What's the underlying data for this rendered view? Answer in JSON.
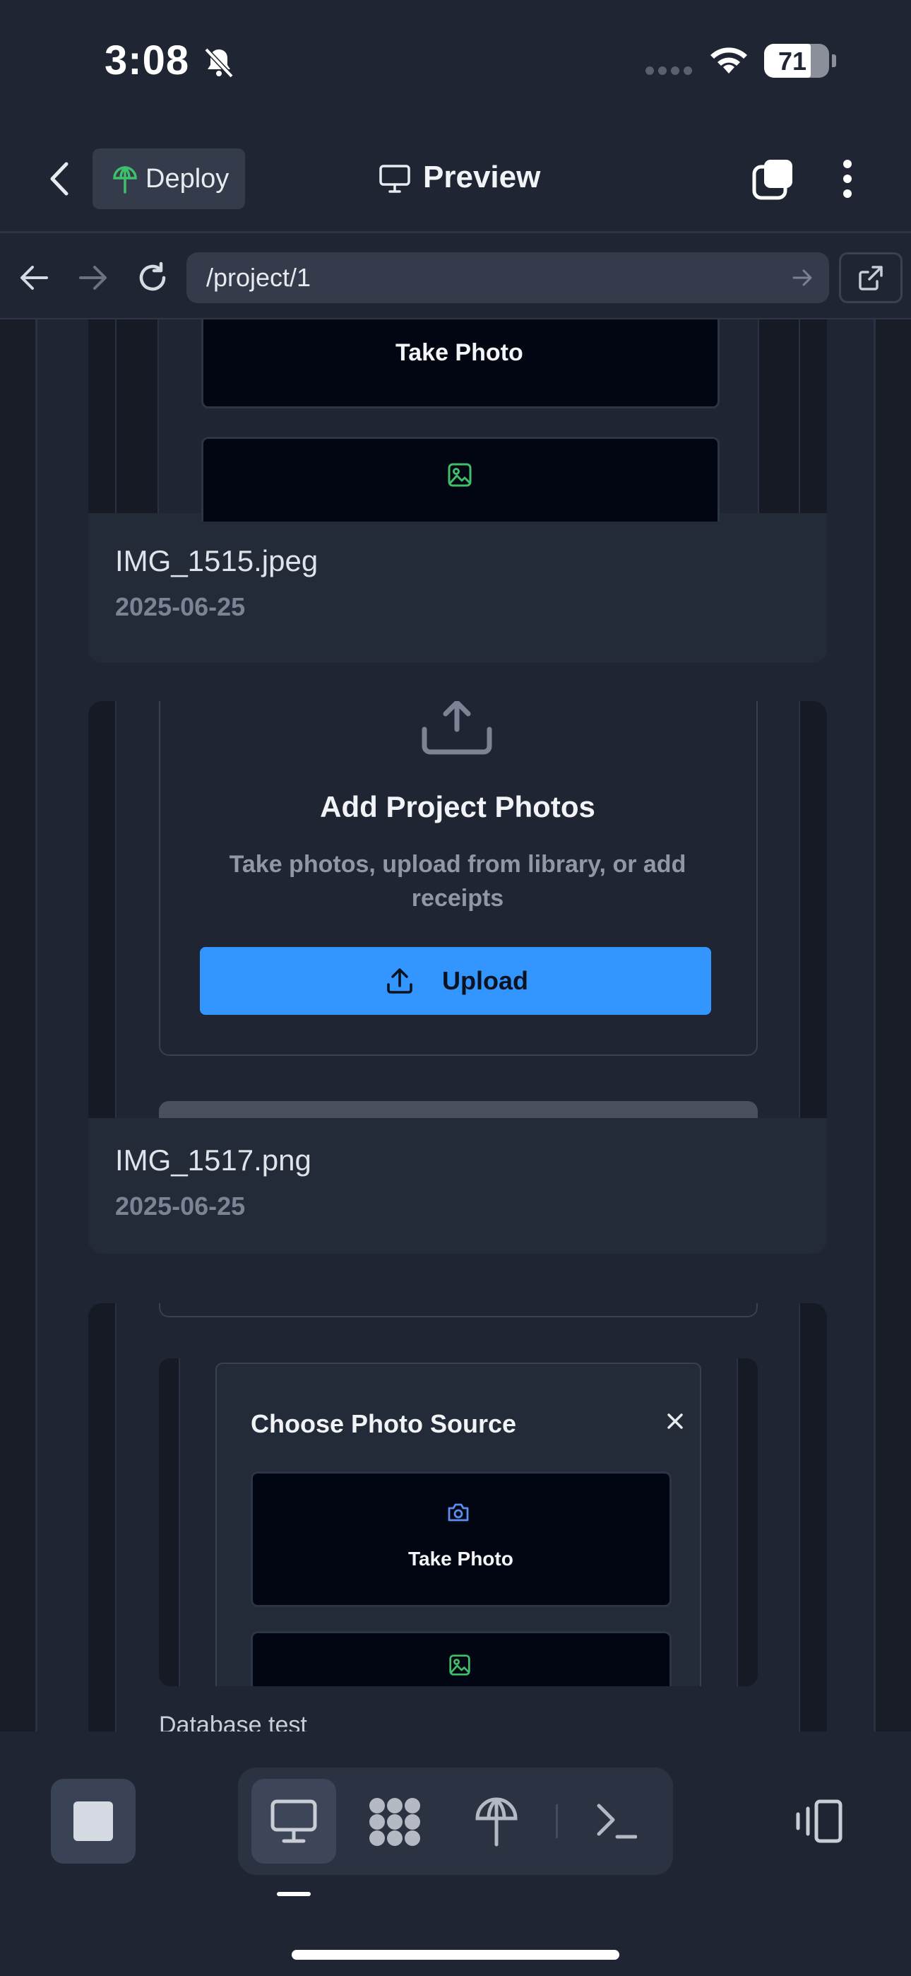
{
  "status_bar": {
    "time": "3:08",
    "battery": "71"
  },
  "header": {
    "deploy_label": "Deploy",
    "preview_label": "Preview"
  },
  "url_bar": {
    "path": "/project/1"
  },
  "top_card": {
    "take_photo_label": "Take Photo",
    "file_name": "IMG_1515.jpeg",
    "date": "2025-06-25"
  },
  "middle_card": {
    "heading": "Add Project Photos",
    "description_line1": "Take photos, upload from library, or add",
    "description_line2": "receipts",
    "upload_label": "Upload",
    "file_name": "IMG_1517.png",
    "date": "2025-06-25"
  },
  "bottom_card": {
    "dialog_title": "Choose Photo Source",
    "take_photo_label": "Take Photo",
    "caption": "Database test"
  },
  "colors": {
    "accent": "#3396ff",
    "image_icon": "#3fbf6a",
    "camera_icon": "#5b8def"
  }
}
